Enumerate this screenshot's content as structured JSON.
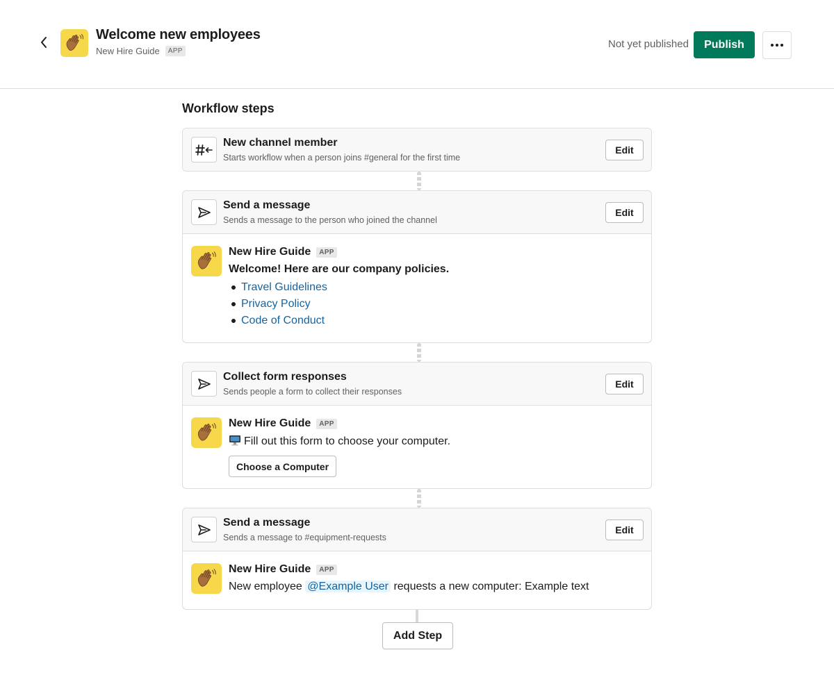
{
  "header": {
    "title": "Welcome new employees",
    "app_name": "New Hire Guide",
    "app_badge": "APP",
    "status": "Not yet published",
    "publish_label": "Publish"
  },
  "section_title": "Workflow steps",
  "edit_label": "Edit",
  "steps": [
    {
      "title": "New channel member",
      "description": "Starts workflow when a person joins #general for the first time",
      "icon": "channel-join-icon"
    },
    {
      "title": "Send a message",
      "description": "Sends a message to the person who joined the channel",
      "icon": "send-icon",
      "message": {
        "sender": "New Hire Guide",
        "badge": "APP",
        "text": "Welcome! Here are our company policies.",
        "links": [
          "Travel Guidelines",
          "Privacy Policy",
          "Code of Conduct"
        ]
      }
    },
    {
      "title": "Collect form responses",
      "description": "Sends people a form to collect their responses",
      "icon": "send-icon",
      "message": {
        "sender": "New Hire Guide",
        "badge": "APP",
        "text": "Fill out this form to choose your computer.",
        "button": "Choose a Computer"
      }
    },
    {
      "title": "Send a message",
      "description": "Sends a message to #equipment-requests",
      "icon": "send-icon",
      "message": {
        "sender": "New Hire Guide",
        "badge": "APP",
        "text_before": "New employee",
        "mention": "@Example User",
        "text_after": "requests a new computer: Example text"
      }
    }
  ],
  "add_step_label": "Add Step",
  "colors": {
    "publish": "#007a5a",
    "link": "#1264a3",
    "avatar_bg": "#f7d84b"
  }
}
